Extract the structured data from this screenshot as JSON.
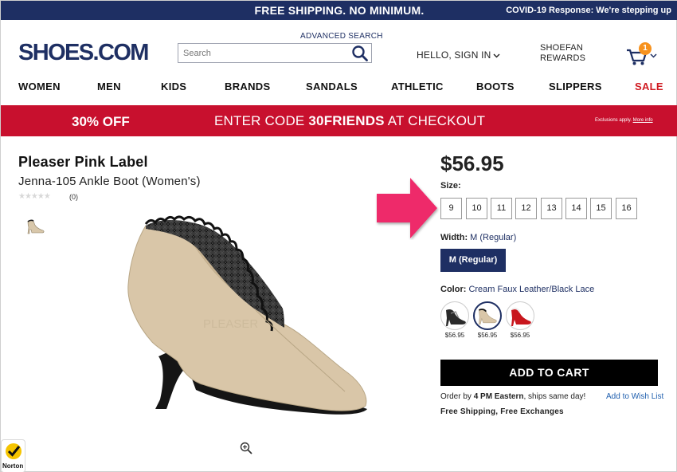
{
  "topbar": {
    "shipping": "FREE SHIPPING. NO MINIMUM.",
    "covid": "COVID-19 Response: We're stepping up"
  },
  "header": {
    "logo": "SHOES.COM",
    "advanced_search": "ADVANCED SEARCH",
    "search_placeholder": "Search",
    "hello": "HELLO, SIGN IN",
    "rewards_line1": "SHOEFAN",
    "rewards_line2": "REWARDS",
    "cart_count": "1"
  },
  "nav": [
    "WOMEN",
    "MEN",
    "KIDS",
    "BRANDS",
    "SANDALS",
    "ATHLETIC",
    "BOOTS",
    "SLIPPERS",
    "SALE"
  ],
  "promo": {
    "discount": "30% OFF",
    "code_prefix": "ENTER CODE ",
    "code": "30FRIENDS",
    "code_suffix": " AT CHECKOUT",
    "exclusions": "Exclusions apply. ",
    "more_info": "More info"
  },
  "product": {
    "brand": "Pleaser Pink Label",
    "name": "Jenna-105 Ankle Boot (Women's)",
    "stars": "★★★★★",
    "reviews": "(0)",
    "watermark": "PLEASER",
    "price": "$56.95",
    "size_label": "Size:",
    "sizes": [
      "9",
      "10",
      "11",
      "12",
      "13",
      "14",
      "15",
      "16"
    ],
    "width_label": "Width:",
    "width_value": "M (Regular)",
    "width_button": "M (Regular)",
    "color_label": "Color:",
    "color_value": "Cream Faux Leather/Black Lace",
    "swatches": [
      {
        "price": "$56.95",
        "color": "#2a2a2a"
      },
      {
        "price": "$56.95",
        "color": "#d9c6a8"
      },
      {
        "price": "$56.95",
        "color": "#c8161d"
      }
    ],
    "add_to_cart": "ADD TO CART",
    "order_prefix": "Order by ",
    "order_time": "4 PM Eastern",
    "order_suffix": ", ships same day!",
    "wishlist": "Add to Wish List",
    "free": "Free Shipping, Free Exchanges"
  },
  "norton": "Norton",
  "colors": {
    "navy": "#1e2f63",
    "promo_red": "#c8102e",
    "arrow_pink": "#ee2a6b",
    "cart_orange": "#f7921e"
  }
}
